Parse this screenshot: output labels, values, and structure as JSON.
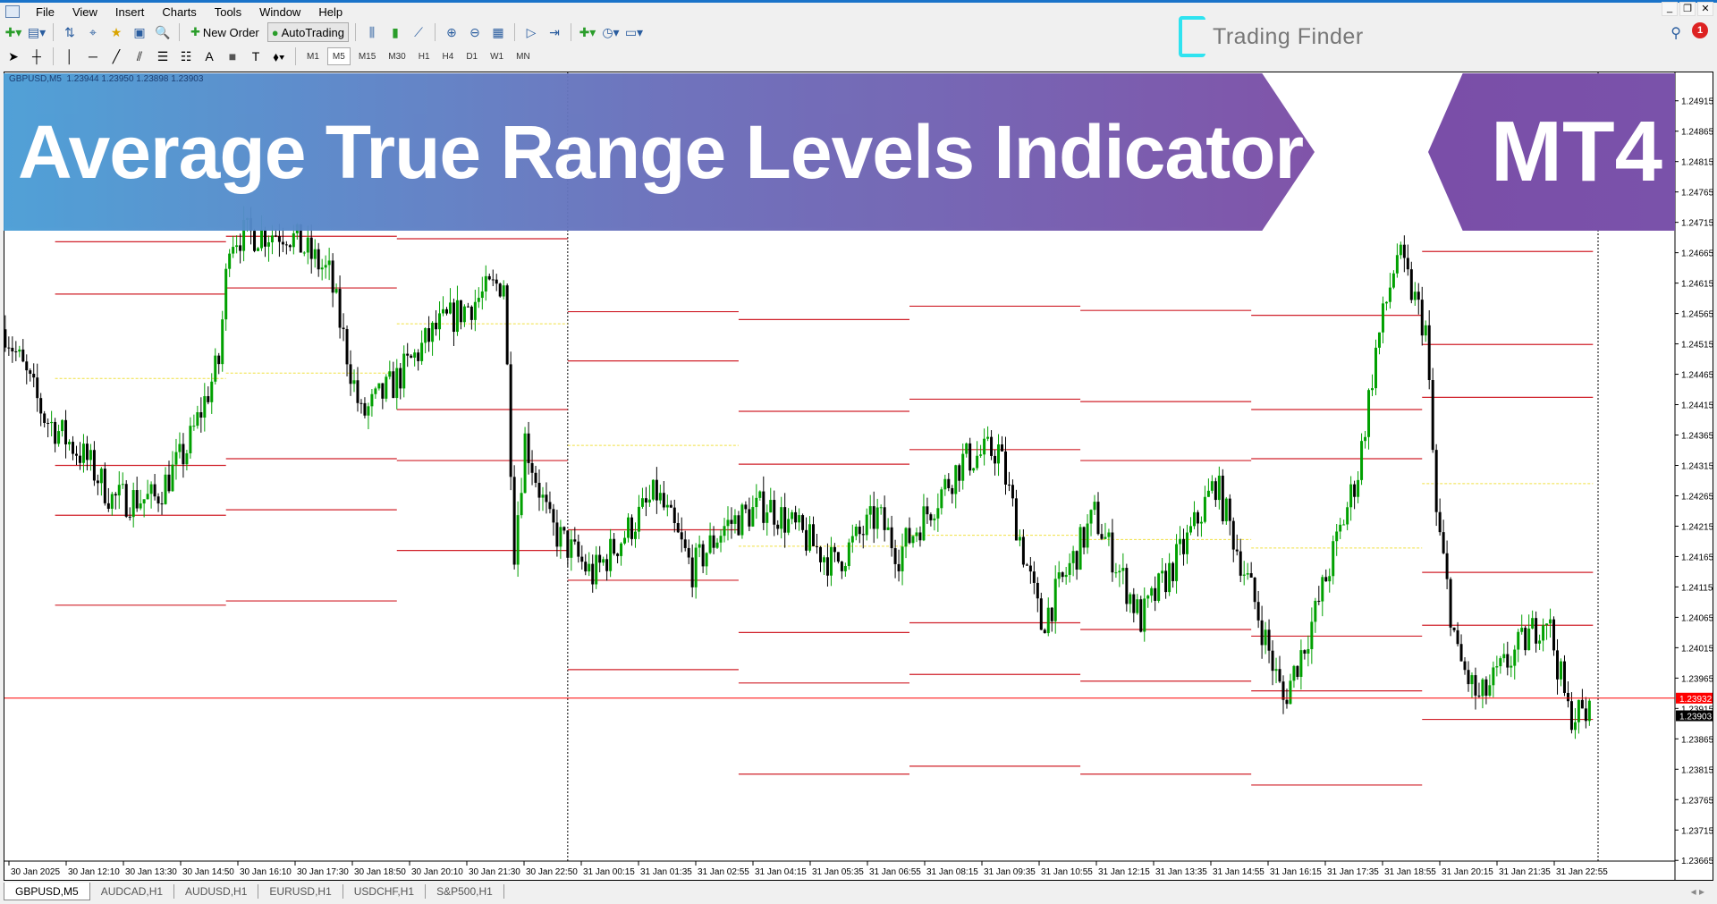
{
  "menu": [
    "File",
    "View",
    "Insert",
    "Charts",
    "Tools",
    "Window",
    "Help"
  ],
  "toolbar": {
    "new_order": "New Order",
    "auto_trading": "AutoTrading",
    "timeframes": [
      "M1",
      "M5",
      "M15",
      "M30",
      "H1",
      "H4",
      "D1",
      "W1",
      "MN"
    ],
    "active_timeframe": "M5"
  },
  "brand": {
    "name": "Trading Finder",
    "accent": "#2fe3f0"
  },
  "notification_count": "1",
  "banner": {
    "title": "Average True Range Levels Indicator",
    "platform": "MT4",
    "gradient": [
      "#4a9ed6",
      "#7b4ea6"
    ]
  },
  "chart": {
    "header": "GBPUSD,M5  1.23944 1.23950 1.23898 1.23903",
    "symbol": "GBPUSD",
    "timeframe": "M5",
    "ohlc": {
      "open": 1.23944,
      "high": 1.2395,
      "low": 1.23898,
      "close": 1.23903
    },
    "bid": "1.23932",
    "last": "1.23903",
    "colors": {
      "bull": "#00a000",
      "bear": "#000000",
      "level": "#d0202a",
      "mid": "#f0e040",
      "bid": "#ff0000"
    },
    "price_ticks": [
      "1.24915",
      "1.24865",
      "1.24815",
      "1.24765",
      "1.24715",
      "1.24665",
      "1.24615",
      "1.24565",
      "1.24515",
      "1.24465",
      "1.24415",
      "1.24365",
      "1.24315",
      "1.24265",
      "1.24215",
      "1.24165",
      "1.24115",
      "1.24065",
      "1.24015",
      "1.23965",
      "1.23915",
      "1.23865",
      "1.23815",
      "1.23765",
      "1.23715",
      "1.23665"
    ],
    "time_ticks": [
      "30 Jan 2025",
      "30 Jan 12:10",
      "30 Jan 13:30",
      "30 Jan 14:50",
      "30 Jan 16:10",
      "30 Jan 17:30",
      "30 Jan 18:50",
      "30 Jan 20:10",
      "30 Jan 21:30",
      "30 Jan 22:50",
      "31 Jan 00:15",
      "31 Jan 01:35",
      "31 Jan 02:55",
      "31 Jan 04:15",
      "31 Jan 05:35",
      "31 Jan 06:55",
      "31 Jan 08:15",
      "31 Jan 09:35",
      "31 Jan 10:55",
      "31 Jan 12:15",
      "31 Jan 13:35",
      "31 Jan 14:55",
      "31 Jan 16:15",
      "31 Jan 17:35",
      "31 Jan 18:55",
      "31 Jan 20:15",
      "31 Jan 21:35",
      "31 Jan 22:55"
    ],
    "atr_levels": [
      {
        "start": "30 Jan 12:00",
        "levels": [
          1.24683,
          1.24597,
          1.24315,
          1.24233,
          1.24085
        ],
        "mid": 1.24458
      },
      {
        "start": "30 Jan 16:00",
        "levels": [
          1.24692,
          1.24607,
          1.24326,
          1.24242,
          1.24092
        ],
        "mid": 1.24467
      },
      {
        "start": "30 Jan 20:00",
        "levels": [
          1.24688,
          1.24407,
          1.24323,
          1.24175
        ],
        "mid": 1.24548
      },
      {
        "start": "31 Jan 00:00",
        "levels": [
          1.24568,
          1.24487,
          1.24209,
          1.24126,
          1.23979
        ],
        "mid": 1.24348
      },
      {
        "start": "31 Jan 04:00",
        "levels": [
          1.24555,
          1.24404,
          1.24317,
          1.2404,
          1.23957,
          1.23807
        ],
        "mid": 1.24182
      },
      {
        "start": "31 Jan 08:00",
        "levels": [
          1.24577,
          1.24424,
          1.24341,
          1.24056,
          1.23971,
          1.2382
        ],
        "mid": 1.242
      },
      {
        "start": "31 Jan 12:00",
        "levels": [
          1.2457,
          1.2442,
          1.24323,
          1.24045,
          1.2396,
          1.23807
        ],
        "mid": 1.24193
      },
      {
        "start": "31 Jan 16:00",
        "levels": [
          1.24562,
          1.24407,
          1.24326,
          1.24034,
          1.23944,
          1.23789
        ],
        "mid": 1.24179
      },
      {
        "start": "31 Jan 20:00",
        "levels": [
          1.24667,
          1.24514,
          1.24427,
          1.24139,
          1.24052,
          1.23897
        ],
        "mid": 1.24285
      }
    ],
    "price_path": [
      [
        "30 Jan 10:50",
        1.24539
      ],
      [
        "30 Jan 11:45",
        1.24395
      ],
      [
        "30 Jan 12:45",
        1.24323
      ],
      [
        "30 Jan 13:20",
        1.2426
      ],
      [
        "30 Jan 14:20",
        1.2426
      ],
      [
        "30 Jan 15:05",
        1.24341
      ],
      [
        "30 Jan 15:50",
        1.24485
      ],
      [
        "30 Jan 16:05",
        1.24692
      ],
      [
        "30 Jan 17:25",
        1.247
      ],
      [
        "30 Jan 18:25",
        1.24629
      ],
      [
        "30 Jan 19:10",
        1.24395
      ],
      [
        "30 Jan 19:55",
        1.24449
      ],
      [
        "30 Jan 20:55",
        1.24539
      ],
      [
        "30 Jan 22:30",
        1.2462
      ],
      [
        "30 Jan 22:45",
        1.24179
      ],
      [
        "30 Jan 23:00",
        1.24359
      ],
      [
        "30 Jan 23:35",
        1.24215
      ],
      [
        "31 Jan 00:35",
        1.24134
      ],
      [
        "31 Jan 02:05",
        1.24269
      ],
      [
        "31 Jan 02:55",
        1.24143
      ],
      [
        "31 Jan 03:40",
        1.24215
      ],
      [
        "31 Jan 04:40",
        1.24251
      ],
      [
        "31 Jan 06:15",
        1.24152
      ],
      [
        "31 Jan 07:15",
        1.24233
      ],
      [
        "31 Jan 07:45",
        1.2417
      ],
      [
        "31 Jan 09:15",
        1.24323
      ],
      [
        "31 Jan 10:05",
        1.24341
      ],
      [
        "31 Jan 11:05",
        1.24052
      ],
      [
        "31 Jan 12:20",
        1.24233
      ],
      [
        "31 Jan 13:25",
        1.24061
      ],
      [
        "31 Jan 14:25",
        1.24179
      ],
      [
        "31 Jan 15:10",
        1.24287
      ],
      [
        "31 Jan 16:05",
        1.24089
      ],
      [
        "31 Jan 16:45",
        1.23927
      ],
      [
        "31 Jan 17:30",
        1.24071
      ],
      [
        "31 Jan 18:30",
        1.24305
      ],
      [
        "31 Jan 18:55",
        1.24503
      ],
      [
        "31 Jan 19:25",
        1.24665
      ],
      [
        "31 Jan 20:05",
        1.24539
      ],
      [
        "31 Jan 20:20",
        1.24233
      ],
      [
        "31 Jan 20:50",
        1.23999
      ],
      [
        "31 Jan 21:20",
        1.23927
      ],
      [
        "31 Jan 22:05",
        1.23999
      ],
      [
        "31 Jan 22:55",
        1.24071
      ],
      [
        "31 Jan 23:25",
        1.23909
      ],
      [
        "31 Jan 23:55",
        1.23903
      ]
    ],
    "day_separator": "31 Jan 00:00"
  },
  "tabs": [
    {
      "label": "GBPUSD,M5",
      "active": true
    },
    {
      "label": "AUDCAD,H1"
    },
    {
      "label": "AUDUSD,H1"
    },
    {
      "label": "EURUSD,H1"
    },
    {
      "label": "USDCHF,H1"
    },
    {
      "label": "S&P500,H1"
    }
  ]
}
